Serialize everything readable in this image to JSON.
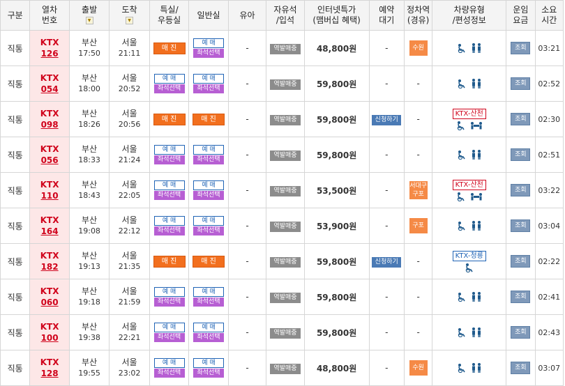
{
  "header": {
    "type": "구분",
    "train_no": "열차\n번호",
    "depart": "출발",
    "arrive": "도착",
    "special": "특실/\n우등실",
    "general": "일반실",
    "infant": "유아",
    "free_seat": "자유석\n/입석",
    "internet_price": "인터넷특가\n(맴버십 혜택)",
    "reserve_wait": "예약\n대기",
    "stop_station": "정차역\n(경유)",
    "car_type": "차량유형\n/편성정보",
    "fare": "운임\n요금",
    "duration": "소요\n시간",
    "sort_icon": "sort-icon"
  },
  "labels": {
    "sold_out": "매 진",
    "book": "예 매",
    "seat_select": "좌석선택",
    "station_sale": "역발매중",
    "wait_apply": "신청하기",
    "fare_lookup": "조회",
    "dash": "-"
  },
  "rows": [
    {
      "type": "직통",
      "train_kind": "KTX",
      "train_no": "126",
      "from": "부산",
      "dep": "17:50",
      "to": "서울",
      "arr": "21:11",
      "special": "sold",
      "general": "book",
      "price": "48,800원",
      "wait": "-",
      "stop": "수원",
      "car_label": "",
      "car_icons": [
        "wheelchair",
        "family"
      ],
      "duration": "03:21"
    },
    {
      "type": "직통",
      "train_kind": "KTX",
      "train_no": "054",
      "from": "부산",
      "dep": "18:00",
      "to": "서울",
      "arr": "20:52",
      "special": "book",
      "general": "book",
      "price": "59,800원",
      "wait": "-",
      "stop": "-",
      "car_label": "",
      "car_icons": [
        "wheelchair",
        "family"
      ],
      "duration": "02:52"
    },
    {
      "type": "직통",
      "train_kind": "KTX",
      "train_no": "098",
      "from": "부산",
      "dep": "18:26",
      "to": "서울",
      "arr": "20:56",
      "special": "sold",
      "general": "sold",
      "price": "59,800원",
      "wait": "apply",
      "stop": "-",
      "car_label": "KTX-산천",
      "car_label_color": "red",
      "car_icons": [
        "wheelchair",
        "meeting"
      ],
      "duration": "02:30"
    },
    {
      "type": "직통",
      "train_kind": "KTX",
      "train_no": "056",
      "from": "부산",
      "dep": "18:33",
      "to": "서울",
      "arr": "21:24",
      "special": "book",
      "general": "book",
      "price": "59,800원",
      "wait": "-",
      "stop": "-",
      "car_label": "",
      "car_icons": [
        "wheelchair",
        "family"
      ],
      "duration": "02:51"
    },
    {
      "type": "직통",
      "train_kind": "KTX",
      "train_no": "110",
      "from": "부산",
      "dep": "18:43",
      "to": "서울",
      "arr": "22:05",
      "special": "book",
      "general": "book",
      "price": "53,500원",
      "wait": "-",
      "stop": "서대구\n구포",
      "car_label": "KTX-산천",
      "car_label_color": "red",
      "car_icons": [
        "wheelchair",
        "meeting"
      ],
      "duration": "03:22"
    },
    {
      "type": "직통",
      "train_kind": "KTX",
      "train_no": "164",
      "from": "부산",
      "dep": "19:08",
      "to": "서울",
      "arr": "22:12",
      "special": "book",
      "general": "book",
      "price": "53,900원",
      "wait": "-",
      "stop": "구포",
      "car_label": "",
      "car_icons": [
        "wheelchair",
        "family"
      ],
      "duration": "03:04"
    },
    {
      "type": "직통",
      "train_kind": "KTX",
      "train_no": "182",
      "from": "부산",
      "dep": "19:13",
      "to": "서울",
      "arr": "21:35",
      "special": "sold",
      "general": "sold",
      "price": "59,800원",
      "wait": "apply",
      "stop": "-",
      "car_label": "KTX-청룡",
      "car_label_color": "blue",
      "car_icons": [
        "wheelchair"
      ],
      "duration": "02:22"
    },
    {
      "type": "직통",
      "train_kind": "KTX",
      "train_no": "060",
      "from": "부산",
      "dep": "19:18",
      "to": "서울",
      "arr": "21:59",
      "special": "book",
      "general": "book",
      "price": "59,800원",
      "wait": "-",
      "stop": "-",
      "car_label": "",
      "car_icons": [
        "wheelchair",
        "family"
      ],
      "duration": "02:41"
    },
    {
      "type": "직통",
      "train_kind": "KTX",
      "train_no": "100",
      "from": "부산",
      "dep": "19:38",
      "to": "서울",
      "arr": "22:21",
      "special": "book",
      "general": "book",
      "price": "59,800원",
      "wait": "-",
      "stop": "-",
      "car_label": "",
      "car_icons": [
        "wheelchair",
        "family"
      ],
      "duration": "02:43"
    },
    {
      "type": "직통",
      "train_kind": "KTX",
      "train_no": "128",
      "from": "부산",
      "dep": "19:55",
      "to": "서울",
      "arr": "23:02",
      "special": "book",
      "general": "book",
      "price": "48,800원",
      "wait": "-",
      "stop": "수원",
      "car_label": "",
      "car_icons": [
        "wheelchair",
        "family"
      ],
      "duration": "03:07"
    }
  ],
  "colors": {
    "sold_out": "#f26f1e",
    "book_border": "#1f63b5",
    "seat_select": "#b75fd3",
    "station_sale": "#8c8c8c",
    "wait_apply": "#4a7ab5",
    "stop_station": "#f58a46",
    "train_no": "#d0021b",
    "fare_btn": "#7f99b9"
  }
}
